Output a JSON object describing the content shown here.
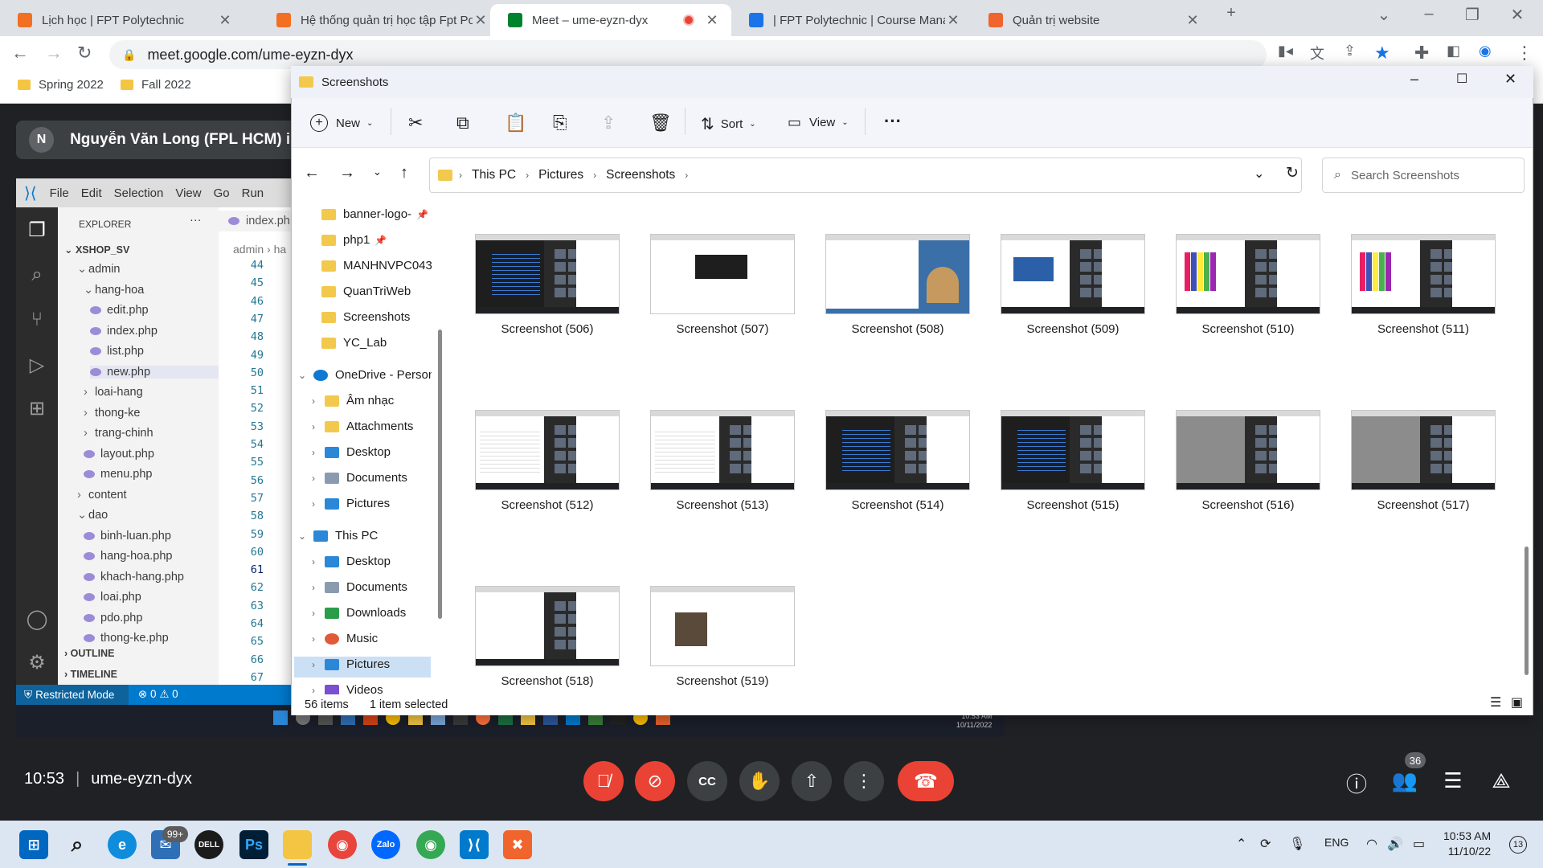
{
  "browser": {
    "tabs": [
      {
        "title": "Lịch học | FPT Polytechnic",
        "color": "#f36f21"
      },
      {
        "title": "Hệ thống quản trị học tập Fpt Po",
        "color": "#f36f21"
      },
      {
        "title": "Meet – ume-eyzn-dyx",
        "color": "#00832d"
      },
      {
        "title": "| FPT Polytechnic | Course Manag",
        "color": "#1a73e8"
      },
      {
        "title": "Quản trị website",
        "color": "#f0642d"
      }
    ],
    "url": "meet.google.com/ume-eyzn-dyx",
    "bookmarks": [
      "Spring 2022",
      "Fall 2022"
    ]
  },
  "meet": {
    "presenter_initial": "N",
    "presenter_banner": "Nguyễn Văn Long (FPL HCM) is p",
    "time": "10:53",
    "meeting_code": "ume-eyzn-dyx",
    "participants_count": "36"
  },
  "vscode": {
    "menu": [
      "File",
      "Edit",
      "Selection",
      "View",
      "Go",
      "Run"
    ],
    "explorer_title": "EXPLORER",
    "open_tab": "index.ph",
    "breadcrumb": "admin",
    "breadcrumb_tail": "ha",
    "project": "XSHOP_SV",
    "tree": [
      {
        "label": "admin",
        "type": "folder",
        "depth": 1
      },
      {
        "label": "hang-hoa",
        "type": "folder",
        "depth": 2
      },
      {
        "label": "edit.php",
        "type": "file",
        "depth": 3
      },
      {
        "label": "index.php",
        "type": "file",
        "depth": 3
      },
      {
        "label": "list.php",
        "type": "file",
        "depth": 3
      },
      {
        "label": "new.php",
        "type": "file",
        "depth": 3
      },
      {
        "label": "loai-hang",
        "type": "folder-closed",
        "depth": 2
      },
      {
        "label": "thong-ke",
        "type": "folder-closed",
        "depth": 2
      },
      {
        "label": "trang-chinh",
        "type": "folder-closed",
        "depth": 2
      },
      {
        "label": "layout.php",
        "type": "file",
        "depth": 2
      },
      {
        "label": "menu.php",
        "type": "file",
        "depth": 2
      },
      {
        "label": "content",
        "type": "folder-closed",
        "depth": 1
      },
      {
        "label": "dao",
        "type": "folder",
        "depth": 1
      },
      {
        "label": "binh-luan.php",
        "type": "file",
        "depth": 2
      },
      {
        "label": "hang-hoa.php",
        "type": "file",
        "depth": 2
      },
      {
        "label": "khach-hang.php",
        "type": "file",
        "depth": 2
      },
      {
        "label": "loai.php",
        "type": "file",
        "depth": 2
      },
      {
        "label": "pdo.php",
        "type": "file",
        "depth": 2
      },
      {
        "label": "thong-ke.php",
        "type": "file",
        "depth": 2
      }
    ],
    "outline": "OUTLINE",
    "timeline": "TIMELINE",
    "line_numbers": [
      "44",
      "45",
      "46",
      "47",
      "48",
      "49",
      "50",
      "51",
      "52",
      "53",
      "54",
      "55",
      "56",
      "57",
      "58",
      "59",
      "60",
      "61",
      "62",
      "63",
      "64",
      "65",
      "66",
      "67"
    ],
    "status_mode": "Restricted Mode",
    "status_problems": "⊗ 0 ⚠ 0"
  },
  "inner_taskbar": {
    "time": "10:53 AM",
    "date": "10/11/2022"
  },
  "explorer": {
    "title": "Screenshots",
    "toolbar": {
      "new": "New",
      "sort": "Sort",
      "view": "View"
    },
    "breadcrumb": [
      "This PC",
      "Pictures",
      "Screenshots"
    ],
    "search_placeholder": "Search Screenshots",
    "nav": [
      {
        "label": "banner-logo-",
        "icon": "folder",
        "pinned": true
      },
      {
        "label": "php1",
        "icon": "folder",
        "pinned": true
      },
      {
        "label": "MANHNVPC043",
        "icon": "folder"
      },
      {
        "label": "QuanTriWeb",
        "icon": "folder"
      },
      {
        "label": "Screenshots",
        "icon": "folder"
      },
      {
        "label": "YC_Lab",
        "icon": "folder"
      },
      {
        "label": "OneDrive - Person",
        "icon": "onedrive",
        "expanded": true
      },
      {
        "label": "Âm nhạc",
        "icon": "folder"
      },
      {
        "label": "Attachments",
        "icon": "folder"
      },
      {
        "label": "Desktop",
        "icon": "desktop"
      },
      {
        "label": "Documents",
        "icon": "documents"
      },
      {
        "label": "Pictures",
        "icon": "pictures"
      },
      {
        "label": "This PC",
        "icon": "thispc",
        "expanded": true
      },
      {
        "label": "Desktop",
        "icon": "desktop"
      },
      {
        "label": "Documents",
        "icon": "documents"
      },
      {
        "label": "Downloads",
        "icon": "downloads"
      },
      {
        "label": "Music",
        "icon": "music"
      },
      {
        "label": "Pictures",
        "icon": "pictures",
        "selected": true
      },
      {
        "label": "Videos",
        "icon": "videos"
      }
    ],
    "files": [
      {
        "name": "Screenshot (506)",
        "style": "code"
      },
      {
        "name": "Screenshot (507)",
        "style": "doc"
      },
      {
        "name": "Screenshot (508)",
        "style": "desktop"
      },
      {
        "name": "Screenshot (509)",
        "style": "meet"
      },
      {
        "name": "Screenshot (510)",
        "style": "colorful"
      },
      {
        "name": "Screenshot (511)",
        "style": "colorful"
      },
      {
        "name": "Screenshot (512)",
        "style": "sheet"
      },
      {
        "name": "Screenshot (513)",
        "style": "sheet"
      },
      {
        "name": "Screenshot (514)",
        "style": "code"
      },
      {
        "name": "Screenshot (515)",
        "style": "code"
      },
      {
        "name": "Screenshot (516)",
        "style": "gray"
      },
      {
        "name": "Screenshot (517)",
        "style": "gray"
      },
      {
        "name": "Screenshot (518)",
        "style": "webpage"
      },
      {
        "name": "Screenshot (519)",
        "style": "quiz"
      }
    ],
    "status_items": "56 items",
    "status_selected": "1 item selected"
  },
  "taskbar": {
    "badge": "99+",
    "lang": "ENG",
    "time": "10:53 AM",
    "date": "11/10/22",
    "notif": "13"
  }
}
